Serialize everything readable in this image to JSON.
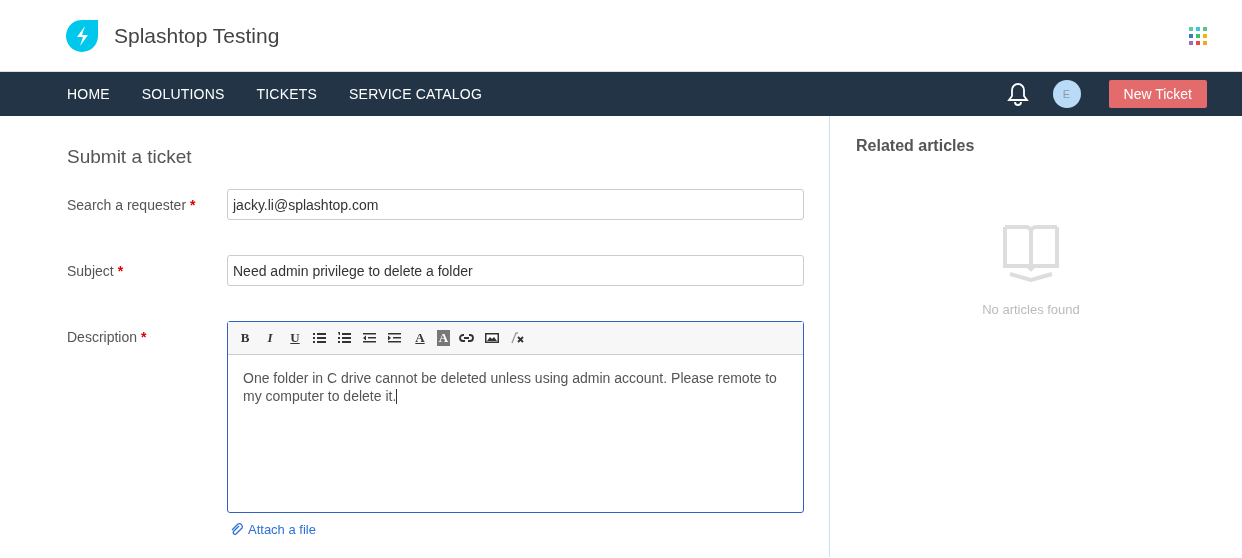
{
  "header": {
    "title": "Splashtop Testing"
  },
  "nav": {
    "items": [
      {
        "label": "HOME"
      },
      {
        "label": "SOLUTIONS"
      },
      {
        "label": "TICKETS"
      },
      {
        "label": "SERVICE CATALOG"
      }
    ],
    "avatar": "E",
    "new_ticket": "New Ticket"
  },
  "form": {
    "title": "Submit a ticket",
    "fields": [
      {
        "kind": "input",
        "label": "Search a requester",
        "required_mark": "*",
        "value": "jacky.li@splashtop.com"
      },
      {
        "kind": "input",
        "label": "Subject",
        "required_mark": "*",
        "value": "Need admin privilege to delete a folder"
      },
      {
        "kind": "editor",
        "label": "Description",
        "required_mark": "*",
        "value": "One folder in C drive cannot be deleted unless using admin account. Please remote to my computer to delete it."
      }
    ],
    "toolbar": [
      {
        "kind": "bold",
        "text": "B"
      },
      {
        "kind": "italic",
        "text": "I"
      },
      {
        "kind": "underline",
        "text": "U"
      },
      {
        "kind": "bullets"
      },
      {
        "kind": "numbers"
      },
      {
        "kind": "outdent"
      },
      {
        "kind": "indent"
      },
      {
        "kind": "font-color",
        "text": "A"
      },
      {
        "kind": "highlight",
        "text": "A"
      },
      {
        "kind": "link"
      },
      {
        "kind": "image"
      },
      {
        "kind": "clear"
      }
    ],
    "attach": "Attach a file"
  },
  "related": {
    "title": "Related articles",
    "empty": "No articles found"
  }
}
